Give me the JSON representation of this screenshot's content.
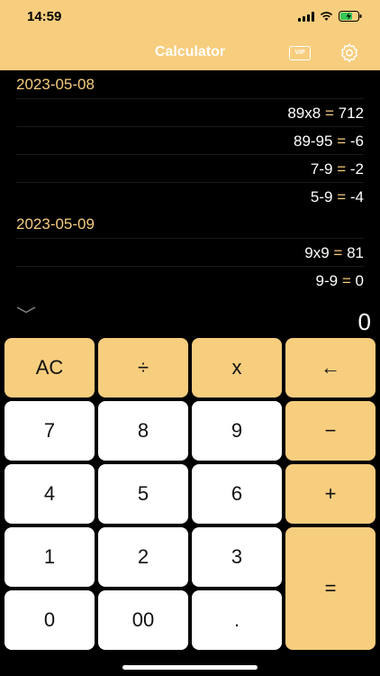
{
  "status": {
    "time": "14:59"
  },
  "header": {
    "title": "Calculator",
    "vip_label": "VIP"
  },
  "history": [
    {
      "date": "2023-05-08",
      "entries": [
        {
          "expr": "89x8",
          "eq": "=",
          "result": "712"
        },
        {
          "expr": "89-95",
          "eq": "=",
          "result": "-6"
        },
        {
          "expr": "7-9",
          "eq": "=",
          "result": "-2"
        },
        {
          "expr": "5-9",
          "eq": "=",
          "result": "-4"
        }
      ]
    },
    {
      "date": "2023-05-09",
      "entries": [
        {
          "expr": "9x9",
          "eq": "=",
          "result": "81"
        },
        {
          "expr": "9-9",
          "eq": "=",
          "result": "0"
        }
      ]
    }
  ],
  "display": {
    "value": "0"
  },
  "keys": {
    "ac": "AC",
    "divide": "÷",
    "multiply": "x",
    "backspace": "←",
    "seven": "7",
    "eight": "8",
    "nine": "9",
    "minus": "−",
    "four": "4",
    "five": "5",
    "six": "6",
    "plus": "+",
    "one": "1",
    "two": "2",
    "three": "3",
    "equals": "=",
    "zero": "0",
    "double_zero": "00",
    "dot": "."
  },
  "colors": {
    "accent": "#F7CD7E",
    "background": "#000000",
    "key": "#FFFFFF"
  }
}
